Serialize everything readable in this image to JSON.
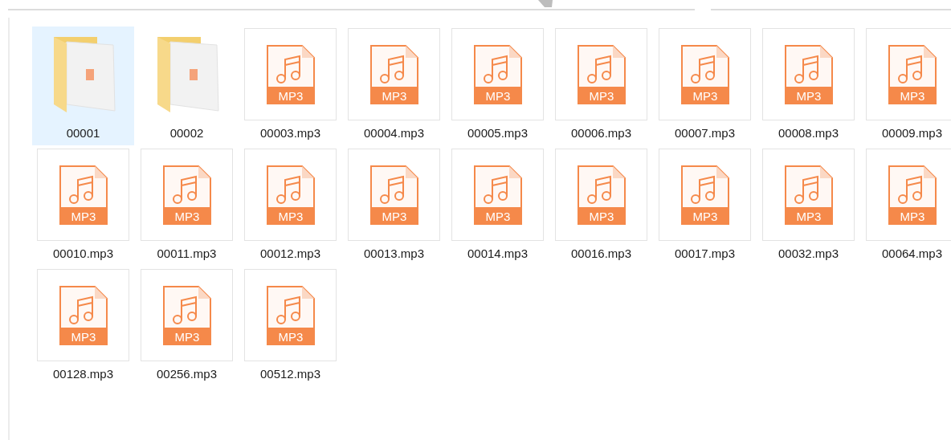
{
  "items": [
    {
      "kind": "folder",
      "name": "00001",
      "selected": true
    },
    {
      "kind": "folder",
      "name": "00002",
      "selected": false
    },
    {
      "kind": "mp3",
      "name": "00003.mp3",
      "badge": "MP3",
      "selected": false
    },
    {
      "kind": "mp3",
      "name": "00004.mp3",
      "badge": "MP3",
      "selected": false
    },
    {
      "kind": "mp3",
      "name": "00005.mp3",
      "badge": "MP3",
      "selected": false
    },
    {
      "kind": "mp3",
      "name": "00006.mp3",
      "badge": "MP3",
      "selected": false
    },
    {
      "kind": "mp3",
      "name": "00007.mp3",
      "badge": "MP3",
      "selected": false
    },
    {
      "kind": "mp3",
      "name": "00008.mp3",
      "badge": "MP3",
      "selected": false
    },
    {
      "kind": "mp3",
      "name": "00009.mp3",
      "badge": "MP3",
      "selected": false
    },
    {
      "kind": "mp3",
      "name": "00010.mp3",
      "badge": "MP3",
      "selected": false
    },
    {
      "kind": "mp3",
      "name": "00011.mp3",
      "badge": "MP3",
      "selected": false
    },
    {
      "kind": "mp3",
      "name": "00012.mp3",
      "badge": "MP3",
      "selected": false
    },
    {
      "kind": "mp3",
      "name": "00013.mp3",
      "badge": "MP3",
      "selected": false
    },
    {
      "kind": "mp3",
      "name": "00014.mp3",
      "badge": "MP3",
      "selected": false
    },
    {
      "kind": "mp3",
      "name": "00016.mp3",
      "badge": "MP3",
      "selected": false
    },
    {
      "kind": "mp3",
      "name": "00017.mp3",
      "badge": "MP3",
      "selected": false
    },
    {
      "kind": "mp3",
      "name": "00032.mp3",
      "badge": "MP3",
      "selected": false
    },
    {
      "kind": "mp3",
      "name": "00064.mp3",
      "badge": "MP3",
      "selected": false
    },
    {
      "kind": "mp3",
      "name": "00128.mp3",
      "badge": "MP3",
      "selected": false
    },
    {
      "kind": "mp3",
      "name": "00256.mp3",
      "badge": "MP3",
      "selected": false
    },
    {
      "kind": "mp3",
      "name": "00512.mp3",
      "badge": "MP3",
      "selected": false
    }
  ]
}
